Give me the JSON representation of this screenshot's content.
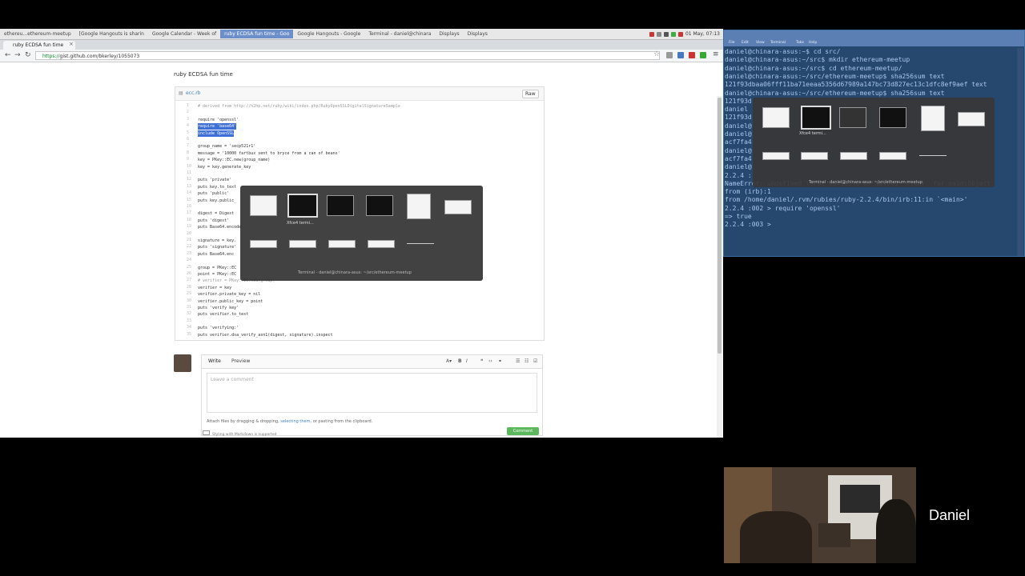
{
  "left_screen": {
    "taskbar": {
      "tasks": [
        "ethereu...ethereum-meetup",
        "[Google Hangouts is sharin",
        "Google Calendar - Week of",
        "ruby ECDSA fun time - Goo",
        "Google Hangouts - Google",
        "Terminal - daniel@chinara",
        "Displays",
        "Displays"
      ],
      "active_index": 3,
      "clock": "01 May, 07:13"
    },
    "browser": {
      "tab_title": "ruby ECDSA fun time",
      "url_scheme": "https://",
      "url_rest": "gist.github.com/bkerley/1055073",
      "page": {
        "gist_title": "ruby ECDSA fun time",
        "file_name": "ecc.rb",
        "raw_label": "Raw",
        "code_lines": [
          {
            "n": "1",
            "text": "# derived from http://h2hp.net/ruby/wiki/index.php/RubyOpenSSLDigitalSignatureSample",
            "cls": "cm"
          },
          {
            "n": "2",
            "text": "",
            "cls": ""
          },
          {
            "n": "3",
            "text": "require 'openssl'",
            "cls": ""
          },
          {
            "n": "4",
            "text": "require 'base64'",
            "cls": "hl"
          },
          {
            "n": "5",
            "text": "include OpenSSL",
            "cls": "hl"
          },
          {
            "n": "6",
            "text": "",
            "cls": ""
          },
          {
            "n": "7",
            "text": "group_name = 'secp521r1'",
            "cls": ""
          },
          {
            "n": "8",
            "text": "message = '10000 fartbux sent to bryce from a can of beans'",
            "cls": ""
          },
          {
            "n": "9",
            "text": "key = PKey::EC.new(group_name)",
            "cls": ""
          },
          {
            "n": "10",
            "text": "key = key.generate_key",
            "cls": ""
          },
          {
            "n": "11",
            "text": "",
            "cls": ""
          },
          {
            "n": "12",
            "text": "puts 'private'",
            "cls": ""
          },
          {
            "n": "13",
            "text": "puts key.to_text",
            "cls": ""
          },
          {
            "n": "14",
            "text": "puts 'public'",
            "cls": ""
          },
          {
            "n": "15",
            "text": "puts key.public_",
            "cls": ""
          },
          {
            "n": "16",
            "text": "",
            "cls": ""
          },
          {
            "n": "17",
            "text": "digest = Digest",
            "cls": ""
          },
          {
            "n": "18",
            "text": "puts 'digest'",
            "cls": ""
          },
          {
            "n": "19",
            "text": "puts Base64.encode",
            "cls": ""
          },
          {
            "n": "20",
            "text": "",
            "cls": ""
          },
          {
            "n": "21",
            "text": "signature = key.",
            "cls": ""
          },
          {
            "n": "22",
            "text": "puts 'signature'",
            "cls": ""
          },
          {
            "n": "23",
            "text": "puts Base64.enc",
            "cls": ""
          },
          {
            "n": "24",
            "text": "",
            "cls": ""
          },
          {
            "n": "25",
            "text": "group = PKey::EC",
            "cls": ""
          },
          {
            "n": "26",
            "text": "point = PKey::EC",
            "cls": ""
          },
          {
            "n": "27",
            "text": "# verifier = PKey::EC.new(group)",
            "cls": "cm"
          },
          {
            "n": "28",
            "text": "verifier = key",
            "cls": ""
          },
          {
            "n": "29",
            "text": "verifier.private_key = nil",
            "cls": ""
          },
          {
            "n": "30",
            "text": "verifier.public_key = point",
            "cls": ""
          },
          {
            "n": "31",
            "text": "puts 'verify key'",
            "cls": ""
          },
          {
            "n": "32",
            "text": "puts verifier.to_text",
            "cls": ""
          },
          {
            "n": "33",
            "text": "",
            "cls": ""
          },
          {
            "n": "34",
            "text": "puts 'verifying:'",
            "cls": ""
          },
          {
            "n": "35",
            "text": "puts verifier.dsa_verify_asn1(digest, signature).inspect",
            "cls": ""
          }
        ],
        "comment": {
          "write_tab": "Write",
          "preview_tab": "Preview",
          "placeholder": "Leave a comment",
          "attach_pre": "Attach files by dragging & dropping, ",
          "attach_link": "selecting them",
          "attach_post": ", or pasting from the clipboard.",
          "markdown_note": "Styling with Markdown is supported",
          "submit": "Comment"
        }
      }
    },
    "switcher": {
      "selected_label": "Xfce4 termi...",
      "caption": "Terminal - daniel@chinara-asus: ~/src/ethereum-meetup"
    }
  },
  "right_screen": {
    "terminal": {
      "menu": [
        "File",
        "Edit",
        "View",
        "Terminal",
        "Tabs",
        "Help"
      ],
      "lines": [
        "daniel@chinara-asus:~$ cd src/",
        "daniel@chinara-asus:~/src$ mkdir ethereum-meetup",
        "daniel@chinara-asus:~/src$ cd ethereum-meetup/",
        "daniel@chinara-asus:~/src/ethereum-meetup$ sha256sum text",
        "121f93dbaa06fff11ba71eeaa5356d67989a147bc73d827ec13c1dfc8ef9aef  text",
        "daniel@chinara-asus:~/src/ethereum-meetup$ sha256sum text",
        "121f93d",
        "daniel",
        "121f93d",
        "daniel@",
        "daniel@",
        "acf7fa4",
        "daniel@",
        "acf7fa4",
        "daniel@",
        "2.2.4 :",
        "NameError: undefined local variable or method `clear' for main:Object",
        "        from (irb):1",
        "        from /home/daniel/.rvm/rubies/ruby-2.2.4/bin/irb:11:in `<main>'",
        "2.2.4 :002 > require 'openssl'",
        " => true",
        "2.2.4 :003 > "
      ],
      "switcher_caption": "Terminal - daniel@chinara-asus: ~/src/ethereum-meetup",
      "switcher_label": "Xfce4 termi..."
    }
  },
  "video": {
    "participant_name": "Daniel"
  }
}
